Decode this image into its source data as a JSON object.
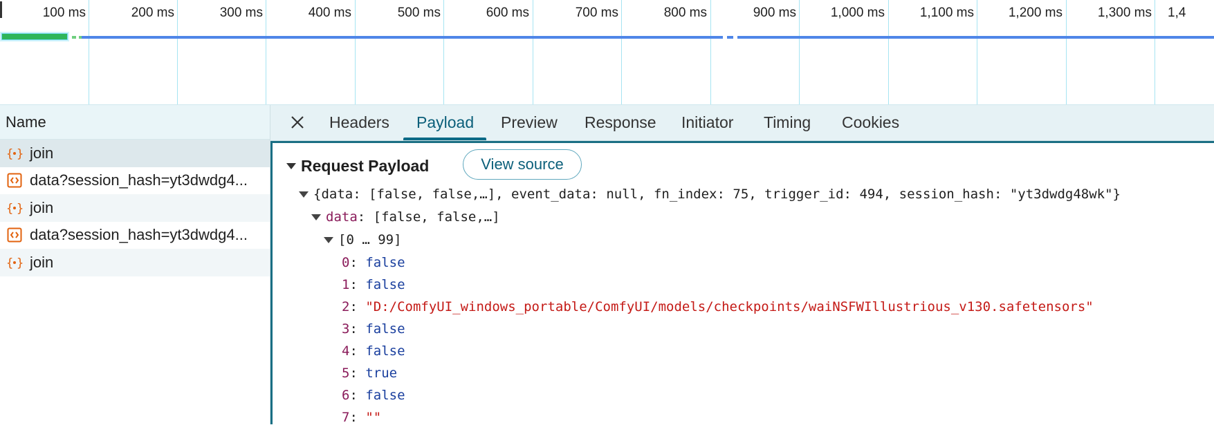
{
  "overview": {
    "ticks": [
      "100 ms",
      "200 ms",
      "300 ms",
      "400 ms",
      "500 ms",
      "600 ms",
      "700 ms",
      "800 ms",
      "900 ms",
      "1,000 ms",
      "1,100 ms",
      "1,200 ms",
      "1,300 ms",
      "1,4"
    ]
  },
  "name_panel": {
    "header": "Name",
    "requests": [
      {
        "label": "join",
        "icon": "fetch-icon"
      },
      {
        "label": "data?session_hash=yt3dwdg4...",
        "icon": "document-icon"
      },
      {
        "label": "join",
        "icon": "fetch-icon"
      },
      {
        "label": "data?session_hash=yt3dwdg4...",
        "icon": "document-icon"
      },
      {
        "label": "join",
        "icon": "fetch-icon"
      }
    ]
  },
  "tabs": [
    "Headers",
    "Payload",
    "Preview",
    "Response",
    "Initiator",
    "Timing",
    "Cookies"
  ],
  "active_tab": "Payload",
  "payload": {
    "section_title": "Request Payload",
    "view_source": "View source",
    "summary": {
      "open": "{",
      "data_key": "data",
      "data_val": "[false, false,…]",
      "event_key": "event_data",
      "event_val": "null",
      "fn_key": "fn_index",
      "fn_val": "75",
      "trigger_key": "trigger_id",
      "trigger_val": "494",
      "session_key": "session_hash",
      "session_val": "\"yt3dwdg48wk\"",
      "close": "}"
    },
    "data_line": {
      "key": "data",
      "val": "[false, false,…]"
    },
    "range": "[0 … 99]",
    "items": [
      {
        "idx": "0",
        "val": "false",
        "type": "bool"
      },
      {
        "idx": "1",
        "val": "false",
        "type": "bool"
      },
      {
        "idx": "2",
        "val": "\"D:/ComfyUI_windows_portable/ComfyUI/models/checkpoints/waiNSFWIllustrious_v130.safetensors\"",
        "type": "string"
      },
      {
        "idx": "3",
        "val": "false",
        "type": "bool"
      },
      {
        "idx": "4",
        "val": "false",
        "type": "bool"
      },
      {
        "idx": "5",
        "val": "true",
        "type": "bool"
      },
      {
        "idx": "6",
        "val": "false",
        "type": "bool"
      },
      {
        "idx": "7",
        "val": "\"\"",
        "type": "string"
      }
    ]
  },
  "colors": {
    "accent": "#0b6a86",
    "track": "#4f86e8",
    "green": "#2fb55a"
  }
}
